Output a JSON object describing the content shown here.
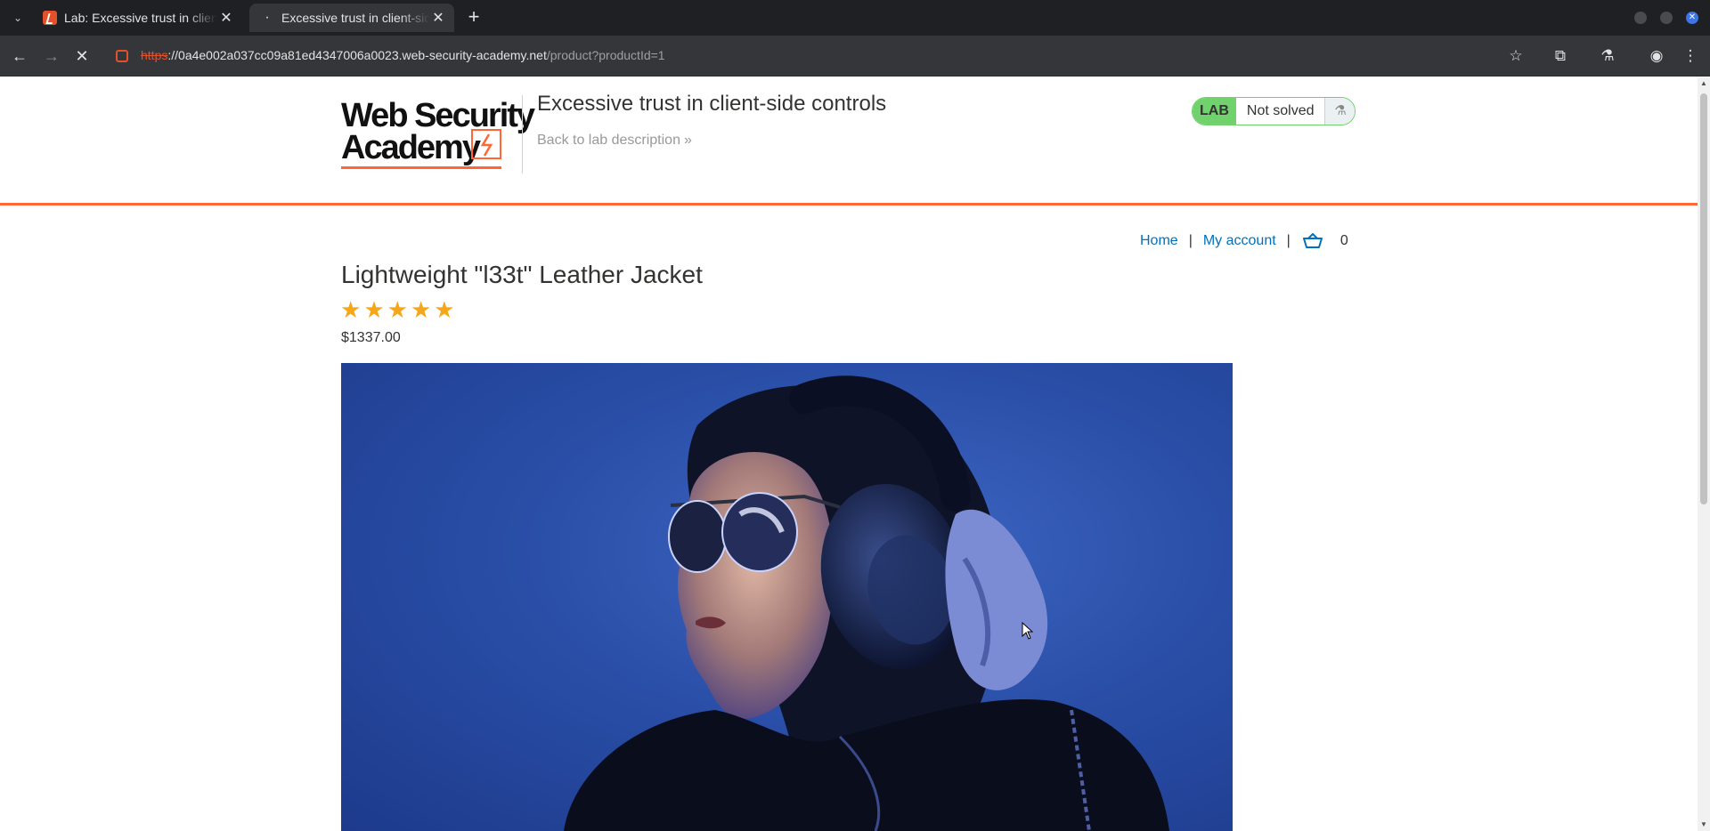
{
  "browser": {
    "tabs": [
      {
        "title": "Lab: Excessive trust in client-side controls",
        "active": false,
        "favicon": "lab-lightning-icon"
      },
      {
        "title": "Excessive trust in client-side controls",
        "active": true,
        "favicon": "loading-icon"
      }
    ],
    "url": {
      "scheme": "https",
      "host": "://0a4e002a037cc09a81ed4347006a0023.web-security-academy.net",
      "path": "/product?productId=1"
    },
    "icons": {
      "back": "back-arrow-icon",
      "forward": "forward-arrow-icon",
      "reload": "stop-loading-icon",
      "bookmark": "star-icon",
      "extensions": "extensions-icon",
      "labs": "flask-icon",
      "profile": "profile-icon",
      "menu": "more-vert-icon"
    }
  },
  "header": {
    "logo_line1": "Web Security",
    "logo_line2": "Academy",
    "lab_title": "Excessive trust in client-side controls",
    "back_link": "Back to lab description",
    "status_label": "LAB",
    "status_value": "Not solved",
    "colors": {
      "accent": "#ff6633",
      "solved_green": "#70d16d"
    }
  },
  "nav": {
    "home": "Home",
    "separator": "|",
    "my_account": "My account",
    "cart_count": "0"
  },
  "product": {
    "title": "Lightweight \"l33t\" Leather Jacket",
    "rating": 5,
    "rating_max": 5,
    "price": "$1337.00",
    "image_alt": "woman wearing headphones and sunglasses in blue light"
  }
}
